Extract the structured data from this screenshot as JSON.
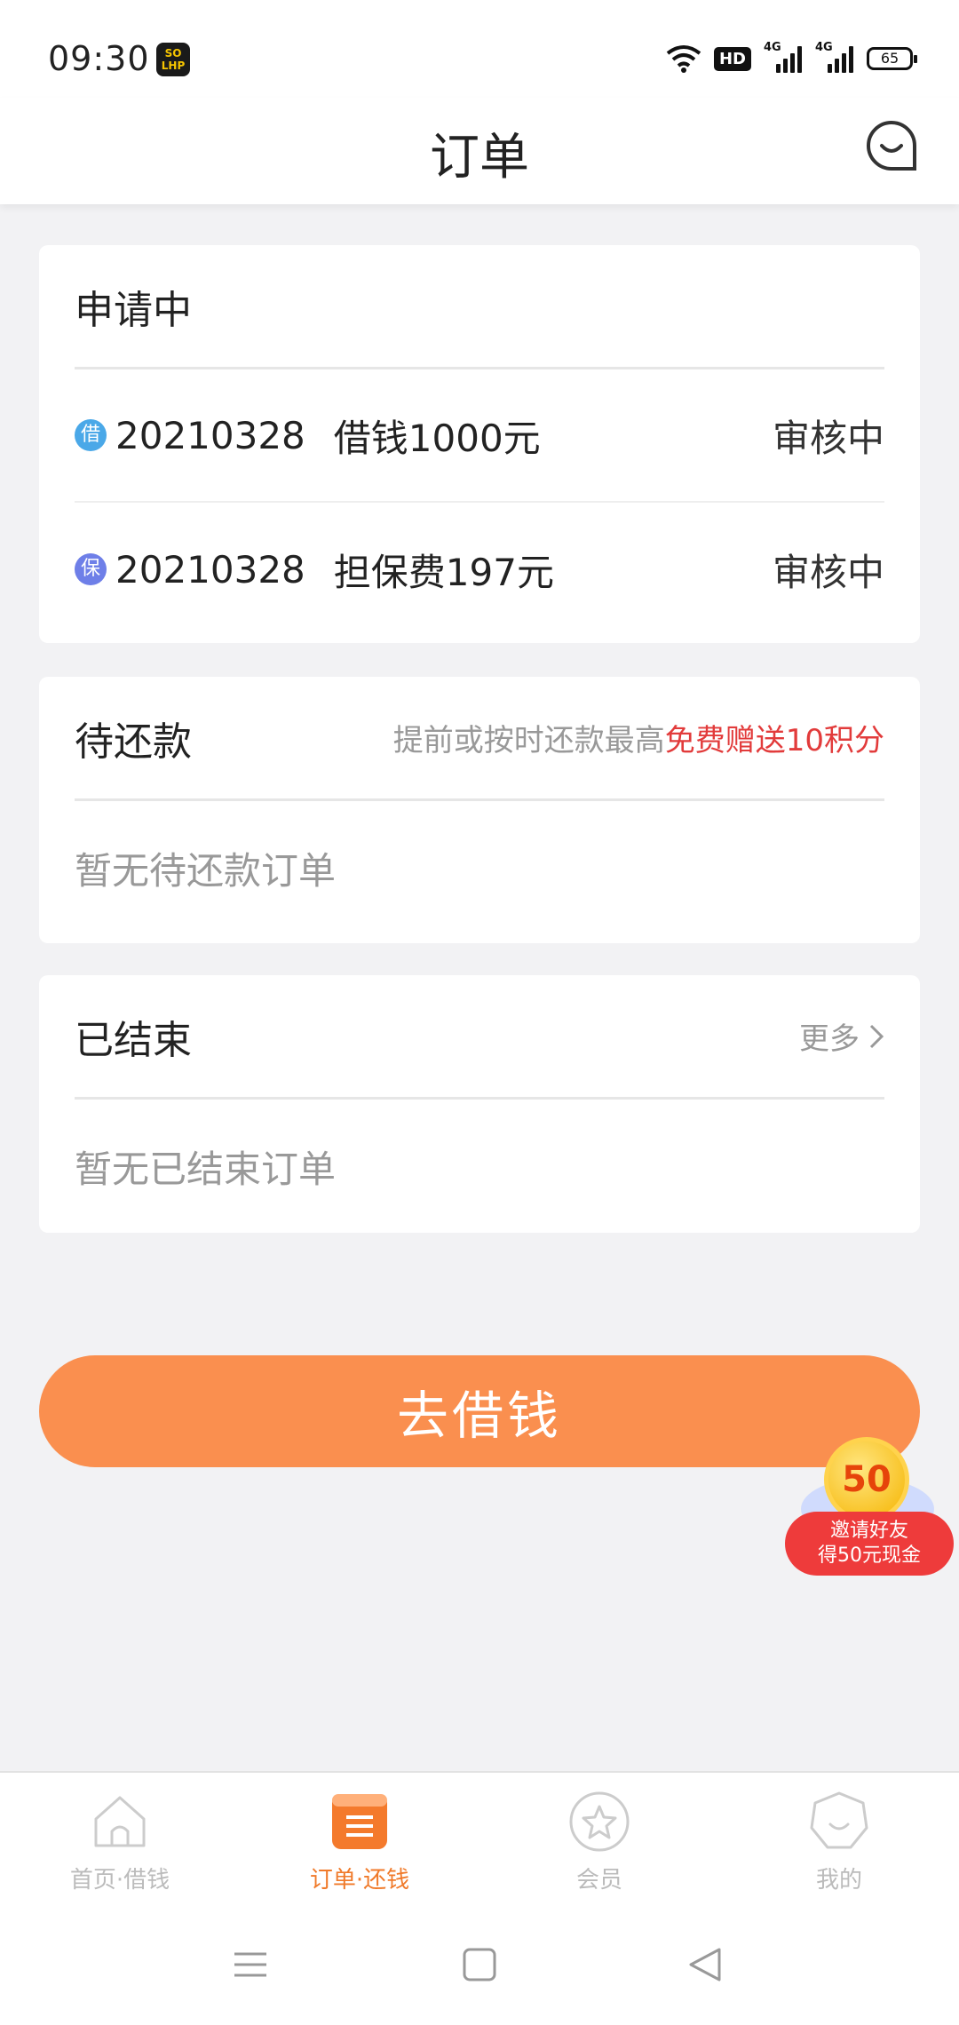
{
  "status_bar": {
    "time": "09:30",
    "app_badge": "SO LHP",
    "hd": "HD",
    "net1": "4G",
    "net2": "4G",
    "battery": "65",
    "icons": [
      "wifi-icon",
      "signal-icon",
      "signal-icon",
      "battery-icon"
    ]
  },
  "header": {
    "title": "订单",
    "chat_icon": "chat-bubble-icon"
  },
  "applying": {
    "title": "申请中",
    "rows": [
      {
        "badge": "借",
        "badge_color": "#4aa8e8",
        "date": "20210328",
        "desc": "借钱1000元",
        "status": "审核中"
      },
      {
        "badge": "保",
        "badge_color": "#6e7fe8",
        "date": "20210328",
        "desc": "担保费197元",
        "status": "审核中"
      }
    ]
  },
  "pending": {
    "title": "待还款",
    "promo_prefix": "提前或按时还款最高",
    "promo_highlight": "免费赠送10积分",
    "empty": "暂无待还款订单"
  },
  "finished": {
    "title": "已结束",
    "more": "更多",
    "empty": "暂无已结束订单"
  },
  "main_button": "去借钱",
  "invite": {
    "coin": "50",
    "line1": "邀请好友",
    "line2": "得50元现金"
  },
  "tabs": [
    {
      "label": "首页·借钱",
      "icon": "home-icon",
      "active": false
    },
    {
      "label": "订单·还钱",
      "icon": "orders-icon",
      "active": true
    },
    {
      "label": "会员",
      "icon": "star-icon",
      "active": false
    },
    {
      "label": "我的",
      "icon": "profile-icon",
      "active": false
    }
  ],
  "colors": {
    "accent": "#fa8f4f",
    "tab_active": "#f07a2a",
    "highlight": "#e23b3b"
  }
}
